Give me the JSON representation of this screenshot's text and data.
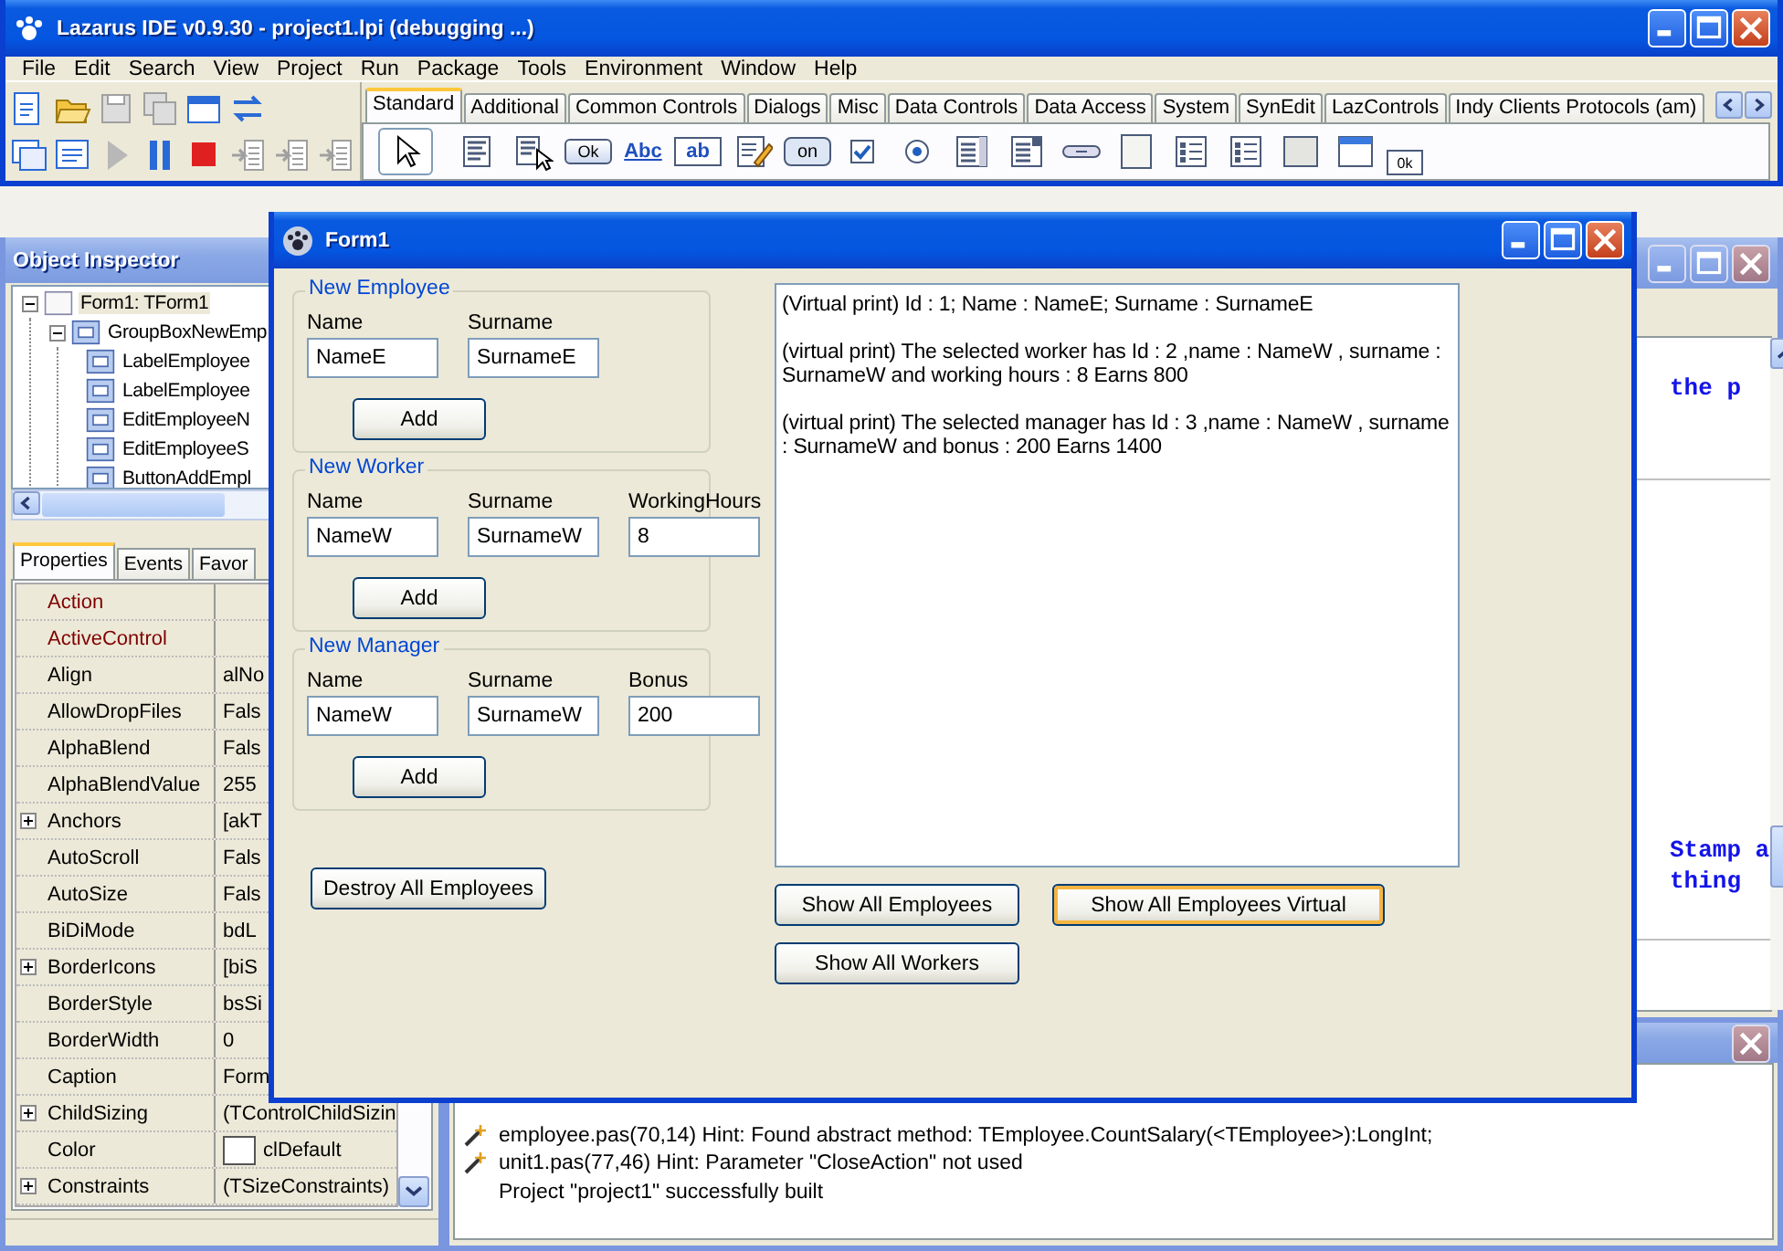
{
  "ide": {
    "title": "Lazarus IDE v0.9.30 - project1.lpi (debugging ...)",
    "menu": [
      "File",
      "Edit",
      "Search",
      "View",
      "Project",
      "Run",
      "Package",
      "Tools",
      "Environment",
      "Window",
      "Help"
    ],
    "toolbar_rows": [
      [
        {
          "kind": "new-unit",
          "disabled": false
        },
        {
          "kind": "open",
          "disabled": false
        },
        {
          "kind": "save",
          "disabled": true
        },
        {
          "kind": "save-all",
          "disabled": true
        },
        {
          "kind": "form",
          "disabled": false
        },
        {
          "kind": "toggle",
          "disabled": false
        }
      ],
      [
        {
          "kind": "new-form",
          "disabled": false
        },
        {
          "kind": "view",
          "disabled": false
        },
        {
          "kind": "run",
          "disabled": true
        },
        {
          "kind": "pause",
          "disabled": false
        },
        {
          "kind": "stop",
          "disabled": false
        },
        {
          "kind": "step-into",
          "disabled": true
        },
        {
          "kind": "step-over",
          "disabled": true
        },
        {
          "kind": "step-out",
          "disabled": true
        }
      ]
    ],
    "palette_tabs": [
      {
        "label": "Standard",
        "selected": true
      },
      {
        "label": "Additional",
        "selected": false
      },
      {
        "label": "Common Controls",
        "selected": false
      },
      {
        "label": "Dialogs",
        "selected": false
      },
      {
        "label": "Misc",
        "selected": false
      },
      {
        "label": "Data Controls",
        "selected": false
      },
      {
        "label": "Data Access",
        "selected": false
      },
      {
        "label": "System",
        "selected": false
      },
      {
        "label": "SynEdit",
        "selected": false
      },
      {
        "label": "LazControls",
        "selected": false
      },
      {
        "label": "Indy Clients Protocols (am)",
        "selected": false
      }
    ],
    "palette": [
      {
        "kind": "pointer",
        "selected": true
      },
      {
        "kind": "menu",
        "selected": false
      },
      {
        "kind": "popup",
        "selected": false
      },
      {
        "kind": "button",
        "label": "Ok",
        "selected": false
      },
      {
        "kind": "label",
        "label": "Abc",
        "selected": false
      },
      {
        "kind": "edit",
        "label": "ab",
        "selected": false
      },
      {
        "kind": "memo",
        "selected": false
      },
      {
        "kind": "toggle",
        "label": "on",
        "selected": false
      },
      {
        "kind": "checkbox",
        "selected": false
      },
      {
        "kind": "radio",
        "selected": false
      },
      {
        "kind": "listbox",
        "selected": false
      },
      {
        "kind": "combobox",
        "selected": false
      },
      {
        "kind": "scrollbar",
        "selected": false
      },
      {
        "kind": "groupbox",
        "selected": false
      },
      {
        "kind": "radiogroup",
        "selected": false
      },
      {
        "kind": "checkgroup",
        "selected": false
      },
      {
        "kind": "panel",
        "selected": false
      },
      {
        "kind": "frame",
        "selected": false
      },
      {
        "kind": "actionlist",
        "label": "0k",
        "selected": false
      }
    ]
  },
  "inspector": {
    "title": "Object Inspector",
    "tree": [
      {
        "label": "Form1: TForm1",
        "selected": true,
        "expanded": true,
        "children": [
          {
            "label": "GroupBoxNewEmp",
            "selected": false,
            "expanded": true,
            "children": [
              {
                "label": "LabelEmployee",
                "selected": false
              },
              {
                "label": "LabelEmployee",
                "selected": false
              },
              {
                "label": "EditEmployeeN",
                "selected": false
              },
              {
                "label": "EditEmployeeS",
                "selected": false
              },
              {
                "label": "ButtonAddEmpl",
                "selected": false
              }
            ]
          }
        ]
      }
    ],
    "tabs": [
      {
        "label": "Properties",
        "selected": true
      },
      {
        "label": "Events",
        "selected": false
      },
      {
        "label": "Favor",
        "selected": false
      }
    ],
    "properties": [
      {
        "name": "Action",
        "kind": "reference"
      },
      {
        "name": "ActiveControl",
        "kind": "reference"
      },
      {
        "name": "Align",
        "kind": "plain",
        "value": "alNo"
      },
      {
        "name": "AllowDropFiles",
        "kind": "plain",
        "value": "Fals"
      },
      {
        "name": "AlphaBlend",
        "kind": "plain",
        "value": "Fals"
      },
      {
        "name": "AlphaBlendValue",
        "kind": "plain",
        "value": "255"
      },
      {
        "name": "Anchors",
        "kind": "group",
        "value": "[akT"
      },
      {
        "name": "AutoScroll",
        "kind": "plain",
        "value": "Fals"
      },
      {
        "name": "AutoSize",
        "kind": "plain",
        "value": "Fals"
      },
      {
        "name": "BiDiMode",
        "kind": "plain",
        "value": "bdL"
      },
      {
        "name": "BorderIcons",
        "kind": "group",
        "value": "[biS"
      },
      {
        "name": "BorderStyle",
        "kind": "plain",
        "value": "bsSi"
      },
      {
        "name": "BorderWidth",
        "kind": "plain",
        "value": "0"
      },
      {
        "name": "Caption",
        "kind": "plain",
        "value": "Form"
      },
      {
        "name": "ChildSizing",
        "kind": "group",
        "value": "(TControlChildSizin"
      },
      {
        "name": "Color",
        "kind": "color",
        "value": "clDefault"
      },
      {
        "name": "Constraints",
        "kind": "group",
        "value": "(TSizeConstraints)"
      }
    ]
  },
  "editor": {
    "lines": [
      "the p",
      "Stamp a",
      "thing"
    ]
  },
  "messages": [
    {
      "kind": "hint",
      "text": "employee.pas(70,14) Hint: Found abstract method: TEmployee.CountSalary(<TEmployee>):LongInt;"
    },
    {
      "kind": "hint",
      "text": "unit1.pas(77,46) Hint: Parameter \"CloseAction\" not used"
    },
    {
      "kind": "plain",
      "text": "Project \"project1\" successfully built"
    }
  ],
  "form": {
    "title": "Form1",
    "groups": [
      {
        "title": "New Employee",
        "fields": [
          {
            "label": "Name",
            "value": "NameE"
          },
          {
            "label": "Surname",
            "value": "SurnameE"
          }
        ],
        "button": "Add"
      },
      {
        "title": "New Worker",
        "fields": [
          {
            "label": "Name",
            "value": "NameW"
          },
          {
            "label": "Surname",
            "value": "SurnameW"
          },
          {
            "label": "WorkingHours",
            "value": "8"
          }
        ],
        "button": "Add"
      },
      {
        "title": "New Manager",
        "fields": [
          {
            "label": "Name",
            "value": "NameW"
          },
          {
            "label": "Surname",
            "value": "SurnameW"
          },
          {
            "label": "Bonus",
            "value": "200"
          }
        ],
        "button": "Add"
      }
    ],
    "destroy_button": "Destroy All Employees",
    "memo": [
      "(Virtual print) Id : 1; Name : NameE; Surname : SurnameE",
      "(virtual print) The selected worker has Id : 2 ,name : NameW , surname : SurnameW and working hours : 8 Earns 800",
      "(virtual print) The selected manager has Id : 3 ,name : NameW , surname : SurnameW and bonus : 200 Earns 1400"
    ],
    "buttons": [
      {
        "label": "Show All Employees",
        "focused": false
      },
      {
        "label": "Show All Employees Virtual",
        "focused": true
      },
      {
        "label": "Show All Workers",
        "focused": false
      }
    ]
  }
}
